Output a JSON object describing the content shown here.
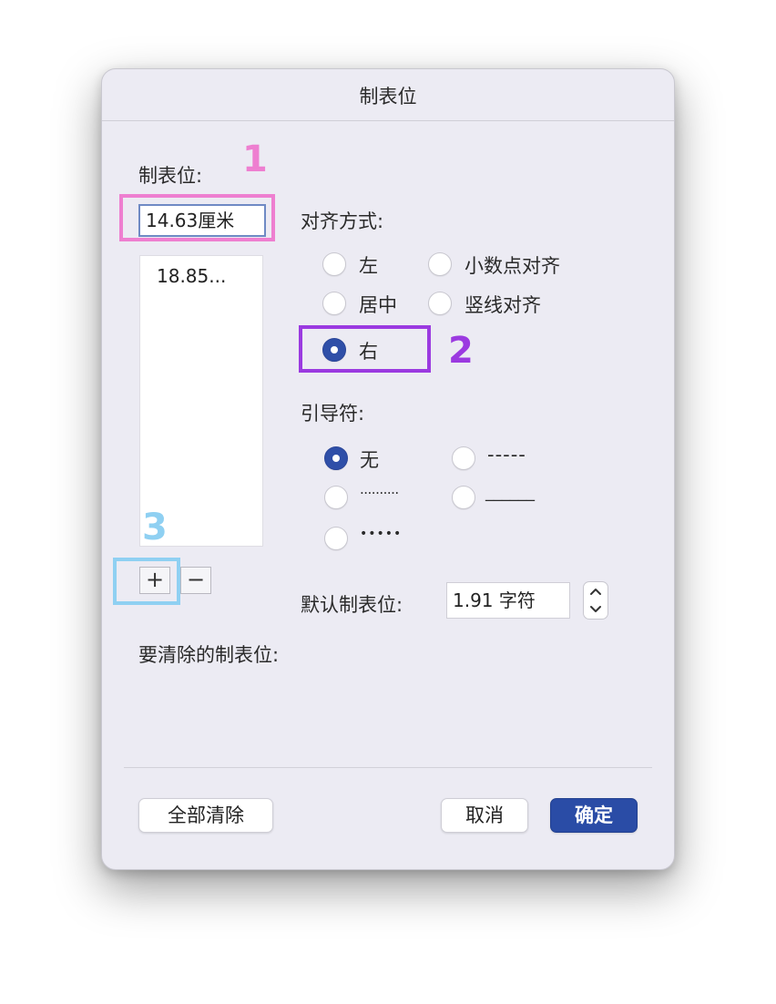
{
  "dialog": {
    "title": "制表位"
  },
  "tab_stops": {
    "label": "制表位:",
    "input_value": "14.63厘米",
    "list": [
      "18.85..."
    ],
    "add_label": "+",
    "remove_label": "−"
  },
  "alignment": {
    "label": "对齐方式:",
    "options": [
      {
        "label": "左",
        "checked": false
      },
      {
        "label": "小数点对齐",
        "checked": false
      },
      {
        "label": "居中",
        "checked": false
      },
      {
        "label": "竖线对齐",
        "checked": false
      },
      {
        "label": "右",
        "checked": true
      }
    ]
  },
  "leader": {
    "label": "引导符:",
    "options": [
      {
        "label": "无",
        "checked": true
      },
      {
        "label": "-----",
        "checked": false
      },
      {
        "label": "..........",
        "checked": false
      },
      {
        "label": "______",
        "checked": false
      },
      {
        "label": "•••••",
        "checked": false
      }
    ]
  },
  "default_tab": {
    "label": "默认制表位:",
    "value": "1.91 字符"
  },
  "clear_label": "要清除的制表位:",
  "buttons": {
    "clear_all": "全部清除",
    "cancel": "取消",
    "ok": "确定"
  },
  "annotations": [
    {
      "label": "1",
      "color": "#ee7fd0"
    },
    {
      "label": "2",
      "color": "#9b3ae0"
    },
    {
      "label": "3",
      "color": "#8fd0f2"
    }
  ],
  "colors": {
    "accent": "#2a4ca6",
    "dialog_bg": "#ecebf3"
  }
}
